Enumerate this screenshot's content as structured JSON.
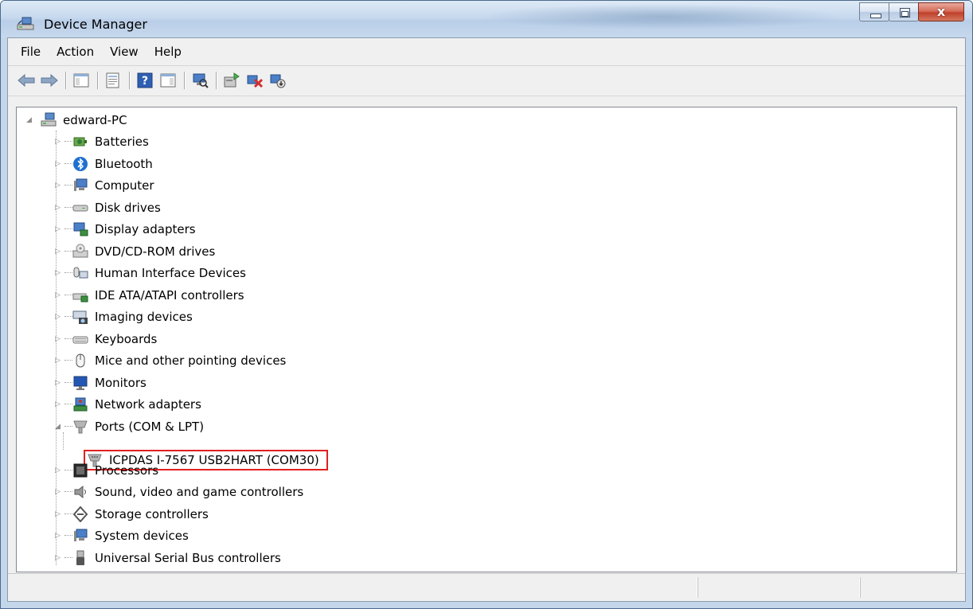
{
  "window": {
    "title": "Device Manager"
  },
  "menu": {
    "items": [
      "File",
      "Action",
      "View",
      "Help"
    ]
  },
  "toolbar": {
    "buttons": [
      "back-icon",
      "forward-icon",
      "show-hide-console-tree-icon",
      "properties-icon",
      "help-icon",
      "show-hide-action-pane-icon",
      "scan-hardware-icon",
      "update-driver-icon",
      "uninstall-icon",
      "enable-disable-icon"
    ]
  },
  "tree": {
    "root": "edward-PC",
    "items": [
      {
        "label": "Batteries",
        "icon": "battery-icon"
      },
      {
        "label": "Bluetooth",
        "icon": "bluetooth-icon"
      },
      {
        "label": "Computer",
        "icon": "computer-icon"
      },
      {
        "label": "Disk drives",
        "icon": "disk-drive-icon"
      },
      {
        "label": "Display adapters",
        "icon": "display-adapter-icon"
      },
      {
        "label": "DVD/CD-ROM drives",
        "icon": "dvd-drive-icon"
      },
      {
        "label": "Human Interface Devices",
        "icon": "hid-icon"
      },
      {
        "label": "IDE ATA/ATAPI controllers",
        "icon": "ide-controller-icon"
      },
      {
        "label": "Imaging devices",
        "icon": "camera-icon"
      },
      {
        "label": "Keyboards",
        "icon": "keyboard-icon"
      },
      {
        "label": "Mice and other pointing devices",
        "icon": "mouse-icon"
      },
      {
        "label": "Monitors",
        "icon": "monitor-icon"
      },
      {
        "label": "Network adapters",
        "icon": "network-adapter-icon"
      },
      {
        "label": "Ports (COM & LPT)",
        "icon": "port-icon",
        "expanded": true
      },
      {
        "label": "Processors",
        "icon": "processor-icon"
      },
      {
        "label": "Sound, video and game controllers",
        "icon": "speaker-icon"
      },
      {
        "label": "Storage controllers",
        "icon": "storage-controller-icon"
      },
      {
        "label": "System devices",
        "icon": "system-device-icon"
      },
      {
        "label": "Universal Serial Bus controllers",
        "icon": "usb-icon"
      }
    ],
    "child": {
      "label": "ICPDAS I-7567 USB2HART (COM30)",
      "icon": "port-icon",
      "highlight_color": "#e02020"
    }
  }
}
